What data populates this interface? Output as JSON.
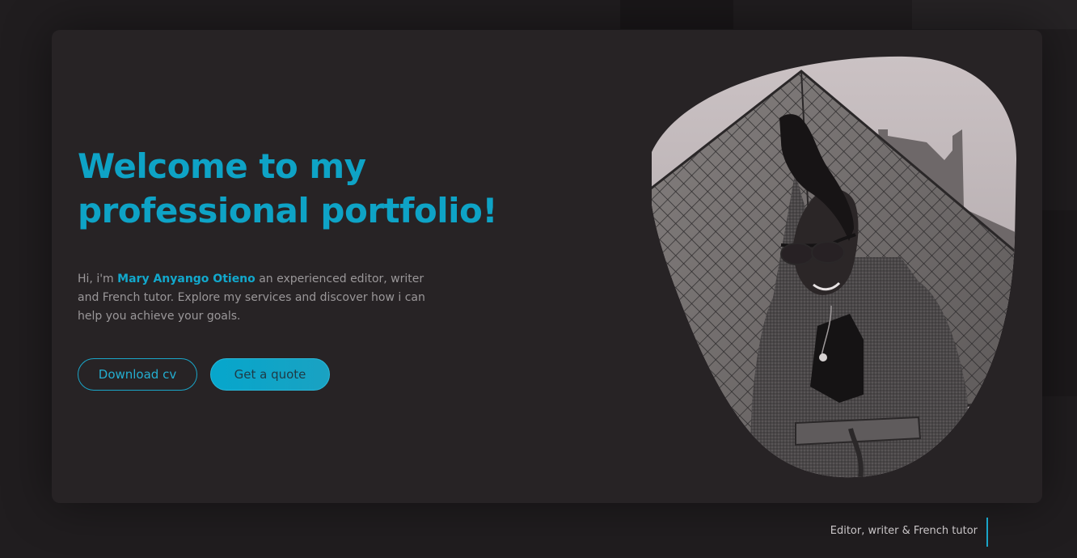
{
  "hero": {
    "headline": "Welcome to my professional portfolio!",
    "intro_prefix": "Hi, i'm ",
    "intro_name": "Mary Anyango Otieno",
    "intro_suffix": " an experienced editor, writer and French tutor. Explore my services and discover how i can help you achieve your goals.",
    "download_label": "Download cv",
    "quote_label": "Get a quote"
  },
  "footer": {
    "tagline": "Editor, writer & French tutor"
  },
  "colors": {
    "accent": "#0ea3c6",
    "background": "#201d1f",
    "card": "#272325"
  }
}
